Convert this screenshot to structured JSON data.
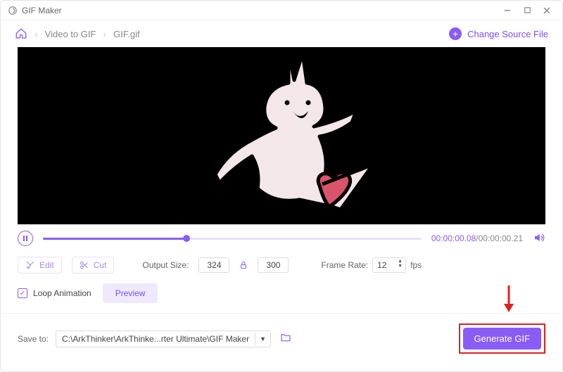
{
  "window": {
    "title": "GIF Maker"
  },
  "breadcrumb": {
    "item1": "Video to GIF",
    "item2": "GIF.gif"
  },
  "actions": {
    "change_source": "Change Source File"
  },
  "playback": {
    "current": "00:00:00.08",
    "total": "00:00:00.21"
  },
  "tools": {
    "edit": "Edit",
    "cut": "Cut"
  },
  "output": {
    "size_label": "Output Size:",
    "width": "324",
    "height": "300",
    "framerate_label": "Frame Rate:",
    "framerate": "12",
    "fps_unit": "fps"
  },
  "loop": {
    "label": "Loop Animation",
    "preview_btn": "Preview"
  },
  "save": {
    "label": "Save to:",
    "path": "C:\\ArkThinker\\ArkThinke...rter Ultimate\\GIF Maker",
    "generate_btn": "Generate GIF"
  }
}
